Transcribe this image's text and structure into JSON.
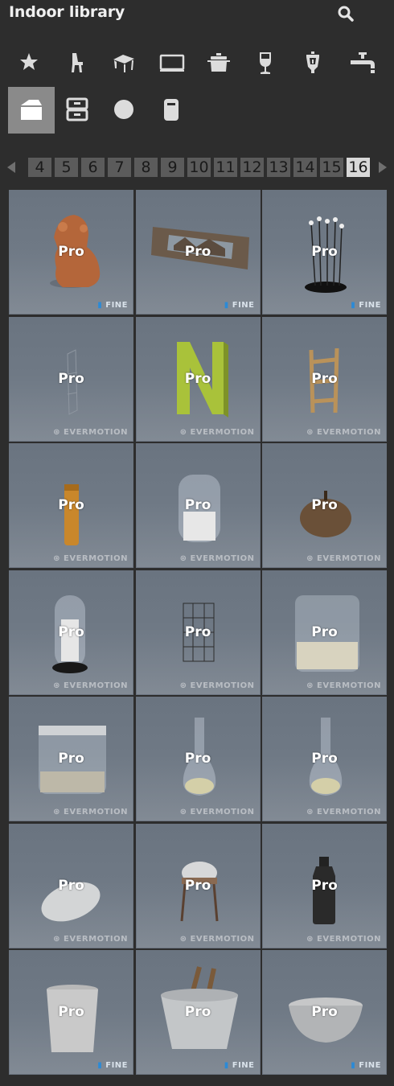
{
  "header": {
    "title": "Indoor library",
    "search_icon": "search-icon"
  },
  "categories": [
    {
      "name": "favorites",
      "icon": "star-icon",
      "active": false
    },
    {
      "name": "chairs",
      "icon": "chair-icon",
      "active": false
    },
    {
      "name": "tables",
      "icon": "table-icon",
      "active": false
    },
    {
      "name": "electronics",
      "icon": "monitor-icon",
      "active": false
    },
    {
      "name": "kitchenware",
      "icon": "pot-icon",
      "active": false
    },
    {
      "name": "glassware",
      "icon": "wine-glass-icon",
      "active": false
    },
    {
      "name": "lighting",
      "icon": "lamp-icon",
      "active": false
    },
    {
      "name": "bathroom",
      "icon": "faucet-icon",
      "active": false
    },
    {
      "name": "decorations",
      "icon": "box-icon",
      "active": true
    },
    {
      "name": "cabinets",
      "icon": "cabinet-icon",
      "active": false
    },
    {
      "name": "spheres",
      "icon": "circle-icon",
      "active": false
    },
    {
      "name": "containers",
      "icon": "canister-icon",
      "active": false
    }
  ],
  "pagination": {
    "prev_icon": "triangle-left-icon",
    "next_icon": "triangle-right-icon",
    "pages": [
      "4",
      "5",
      "6",
      "7",
      "8",
      "9",
      "10",
      "11",
      "12",
      "13",
      "14",
      "15",
      "16"
    ],
    "current": "16"
  },
  "tiles": [
    {
      "badge": "Pro",
      "brand": "FINE",
      "object": "lion-figurine"
    },
    {
      "badge": "Pro",
      "brand": "FINE",
      "object": "cutout-panel"
    },
    {
      "badge": "Pro",
      "brand": "FINE",
      "object": "pin-sculpture"
    },
    {
      "badge": "Pro",
      "brand": "EVERMOTION",
      "object": "wire-frame"
    },
    {
      "badge": "Pro",
      "brand": "EVERMOTION",
      "object": "letter-n"
    },
    {
      "badge": "Pro",
      "brand": "EVERMOTION",
      "object": "wooden-ladder"
    },
    {
      "badge": "Pro",
      "brand": "EVERMOTION",
      "object": "orange-tube"
    },
    {
      "badge": "Pro",
      "brand": "EVERMOTION",
      "object": "glass-jar"
    },
    {
      "badge": "Pro",
      "brand": "EVERMOTION",
      "object": "wooden-pot"
    },
    {
      "badge": "Pro",
      "brand": "EVERMOTION",
      "object": "glass-dome"
    },
    {
      "badge": "Pro",
      "brand": "EVERMOTION",
      "object": "mesh-cube"
    },
    {
      "badge": "Pro",
      "brand": "EVERMOTION",
      "object": "sand-jar"
    },
    {
      "badge": "Pro",
      "brand": "EVERMOTION",
      "object": "wide-jar"
    },
    {
      "badge": "Pro",
      "brand": "EVERMOTION",
      "object": "flask"
    },
    {
      "badge": "Pro",
      "brand": "EVERMOTION",
      "object": "flask-2"
    },
    {
      "badge": "Pro",
      "brand": "EVERMOTION",
      "object": "stone"
    },
    {
      "badge": "Pro",
      "brand": "EVERMOTION",
      "object": "dome-stand"
    },
    {
      "badge": "Pro",
      "brand": "EVERMOTION",
      "object": "dark-bottle"
    },
    {
      "badge": "Pro",
      "brand": "FINE",
      "object": "metal-pail"
    },
    {
      "badge": "Pro",
      "brand": "FINE",
      "object": "bucket-with-tools"
    },
    {
      "badge": "Pro",
      "brand": "FINE",
      "object": "metal-bowl"
    }
  ],
  "colors": {
    "background": "#2d2d2d",
    "active_category": "#8a8a8a",
    "page_bg": "#5b5b5b",
    "page_current_bg": "#d8d8d8",
    "fine_blue": "#2c8ad6"
  }
}
